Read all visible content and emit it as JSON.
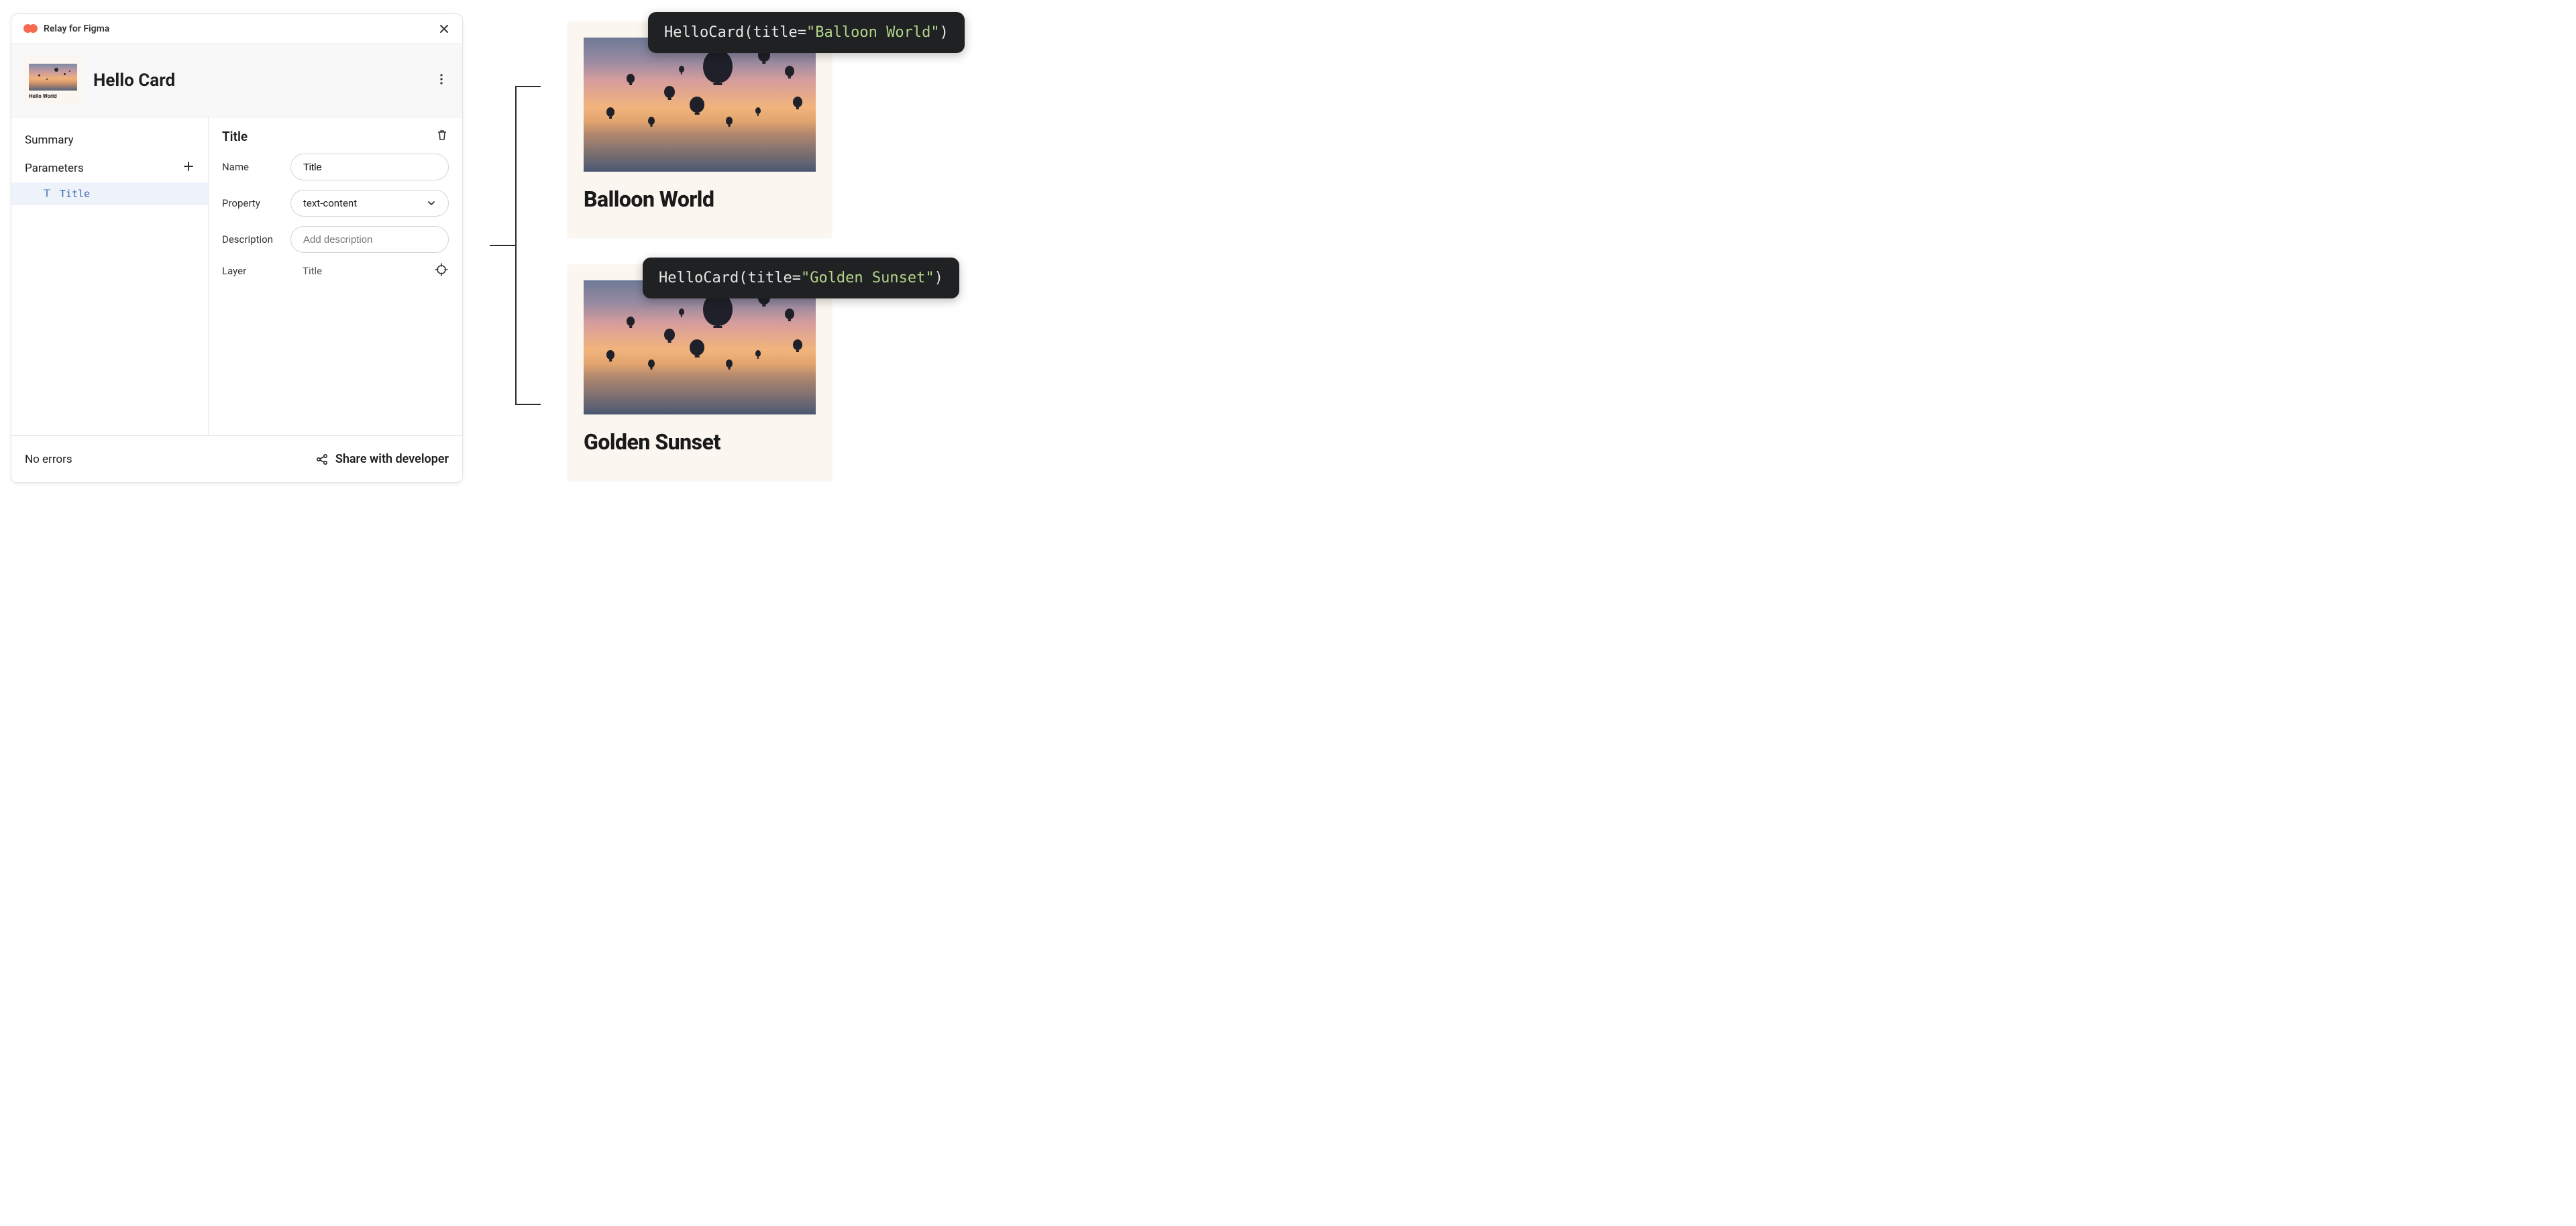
{
  "header": {
    "app_name": "Relay for Figma"
  },
  "component": {
    "name": "Hello Card",
    "thumb_caption": "Hello World"
  },
  "sidebar": {
    "summary_label": "Summary",
    "parameters_label": "Parameters",
    "param_items": [
      {
        "label": "Title"
      }
    ]
  },
  "detail": {
    "heading": "Title",
    "fields": {
      "name_label": "Name",
      "name_value": "Title",
      "property_label": "Property",
      "property_value": "text-content",
      "description_label": "Description",
      "description_placeholder": "Add description",
      "layer_label": "Layer",
      "layer_value": "Title"
    }
  },
  "footer": {
    "status": "No errors",
    "share_label": "Share with developer"
  },
  "code": {
    "fn": "HelloCard",
    "param": "title",
    "call1_value": "\"Balloon World\"",
    "call2_value": "\"Golden Sunset\""
  },
  "previews": {
    "card1_title": "Balloon World",
    "card2_title": "Golden Sunset"
  }
}
